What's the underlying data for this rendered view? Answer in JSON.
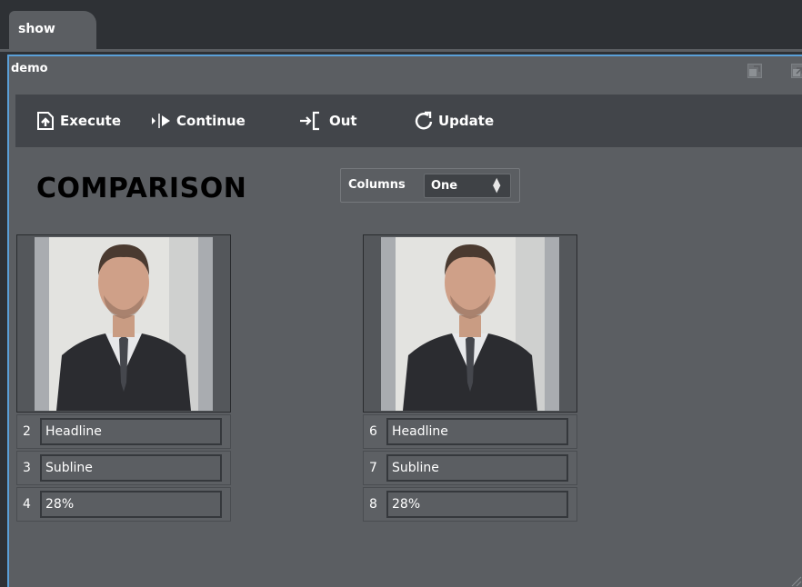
{
  "tab": {
    "label": "show"
  },
  "window": {
    "title": "demo"
  },
  "toolbar": {
    "execute": "Execute",
    "continue": "Continue",
    "out": "Out",
    "update": "Update"
  },
  "heading": "COMPARISON",
  "columns": {
    "label": "Columns",
    "value": "One"
  },
  "cards": [
    {
      "fields": [
        {
          "num": "2",
          "value": "Headline"
        },
        {
          "num": "3",
          "value": "Subline"
        },
        {
          "num": "4",
          "value": "28%"
        }
      ]
    },
    {
      "fields": [
        {
          "num": "6",
          "value": "Headline"
        },
        {
          "num": "7",
          "value": "Subline"
        },
        {
          "num": "8",
          "value": "28%"
        }
      ]
    }
  ],
  "colors": {
    "accent": "#5aa0d8",
    "panel": "#5b5e62",
    "toolbar": "#42454a",
    "background": "#2e3135"
  }
}
